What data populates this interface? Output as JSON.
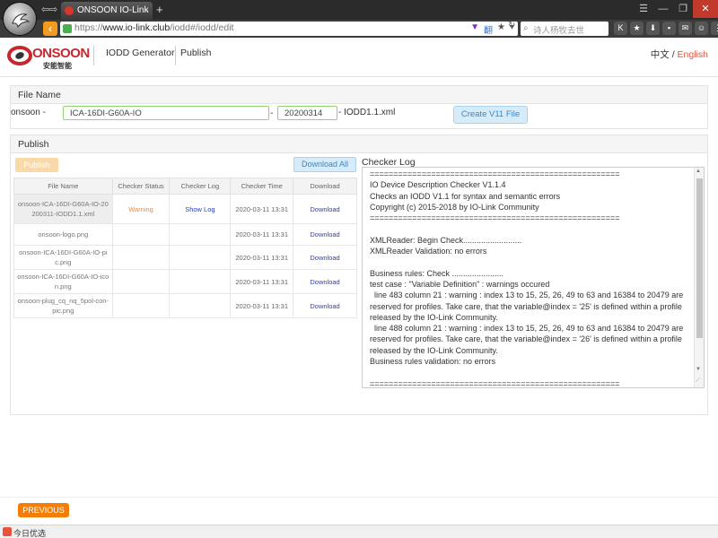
{
  "browser": {
    "tab_title": "ONSOON IO-Link",
    "tab_close": "×",
    "new_tab": "+",
    "back_glyph": "‹",
    "nav_back": "⇦",
    "nav_fwd": "⇨",
    "url_protocol": "https://",
    "url_host": "www.io-link.club",
    "url_path": "/iodd#/iodd/edit",
    "url_icons": [
      "▼",
      "翻",
      "★",
      "▾"
    ],
    "refresh_glyph": "↻",
    "search_placeholder": "诗人杨牧去世",
    "toolbar_icons": [
      "K",
      "★",
      "⬇",
      "▪",
      "✉",
      "☺",
      "⋮"
    ],
    "window_buttons": [
      "☰",
      "—",
      "❐",
      "✕"
    ]
  },
  "header": {
    "brand_name": "ONSOON",
    "brand_sub": "安能智能",
    "nav": [
      "IODD Generator",
      "Publish"
    ],
    "lang_zh": "中文",
    "lang_sep": " / ",
    "lang_en": "English"
  },
  "file_name_panel": {
    "title": "File Name",
    "prefix_label": "onsoon -",
    "product_value": "ICA-16DI-G60A-IO",
    "dash": "-",
    "date_value": "20200314",
    "suffix": "- IODD1.1.xml",
    "create_button": "Create V11 File"
  },
  "publish_panel": {
    "title": "Publish",
    "publish_button": "Publish",
    "download_all_button": "Download All",
    "columns": [
      "File Name",
      "Checker Status",
      "Checker Log",
      "Checker Time",
      "Download"
    ],
    "rows": [
      {
        "file": "onsoon-ICA-16DI-G60A-IO-20200311-IODD1.1.xml",
        "status": "Warning",
        "log": "Show Log",
        "time": "2020-03-11 13:31",
        "download": "Download"
      },
      {
        "file": "onsoon-logo.png",
        "status": "",
        "log": "",
        "time": "2020-03-11 13:31",
        "download": "Download"
      },
      {
        "file": "onsoon-ICA-16DI-G60A-IO-pic.png",
        "status": "",
        "log": "",
        "time": "2020-03-11 13:31",
        "download": "Download"
      },
      {
        "file": "onsoon-ICA-16DI-G60A-IO-icon.png",
        "status": "",
        "log": "",
        "time": "2020-03-11 13:31",
        "download": "Download"
      },
      {
        "file": "onsoon-plug_cq_nq_5pol-con-pic.png",
        "status": "",
        "log": "",
        "time": "2020-03-11 13:31",
        "download": "Download"
      }
    ]
  },
  "checker_log": {
    "title": "Checker Log",
    "text": "=====================================================\nIO Device Description Checker V1.1.4\nChecks an IODD V1.1 for syntax and semantic errors\nCopyright (c) 2015-2018 by IO-Link Community\n=====================================================\n\nXMLReader: Begin Check..........................\nXMLReader Validation: no errors\n\nBusiness rules: Check .......................\ntest case : \"Variable Definition\" : warnings occured\n  line 483 column 21 : warning : index 13 to 15, 25, 26, 49 to 63 and 16384 to 20479 are reserved for profiles. Take care, that the variable@index = '25' is defined within a profile released by the IO-Link Community.\n  line 488 column 21 : warning : index 13 to 15, 25, 26, 49 to 63 and 16384 to 20479 are reserved for profiles. Take care, that the variable@index = '26' is defined within a profile released by the IO-Link Community.\nBusiness rules validation: no errors\n\n=====================================================",
    "scroll_up": "▲",
    "scroll_down": "▼",
    "grip": "⟋"
  },
  "footer": {
    "previous_button": "PREVIOUS"
  },
  "statusbar": {
    "text": "今日优选"
  },
  "colors": {
    "brand_red": "#c7282d",
    "accent_orange": "#f57e02",
    "warning": "#f08c2b",
    "link_blue": "#2c3fb5",
    "input_border_green": "#8fd46c"
  }
}
